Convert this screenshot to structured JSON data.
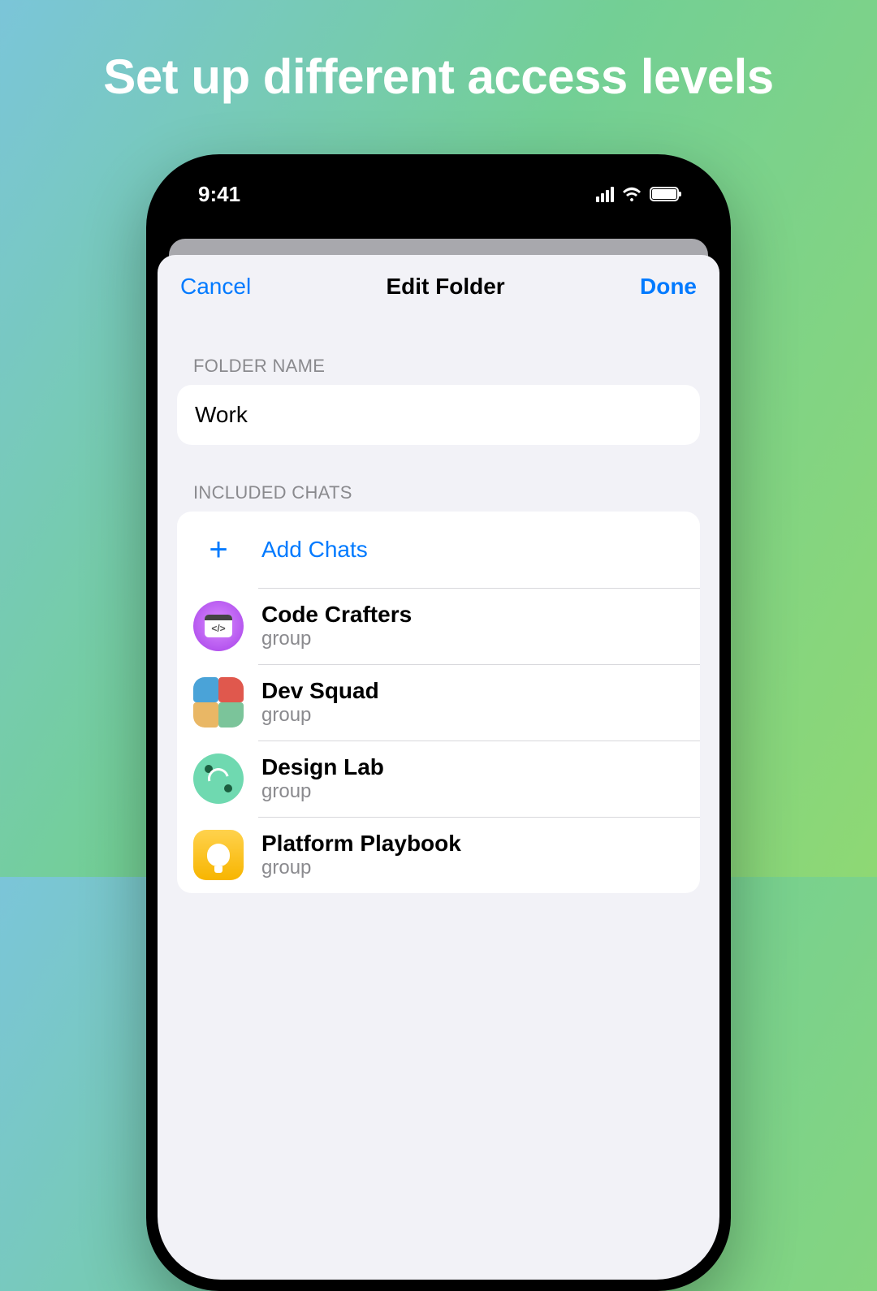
{
  "headline": "Set up different access levels",
  "statusbar": {
    "time": "9:41"
  },
  "navbar": {
    "cancel": "Cancel",
    "title": "Edit Folder",
    "done": "Done"
  },
  "folder_name": {
    "label": "FOLDER NAME",
    "value": "Work"
  },
  "included": {
    "label": "INCLUDED CHATS",
    "add_label": "Add Chats",
    "chats": [
      {
        "title": "Code Crafters",
        "subtitle": "group"
      },
      {
        "title": "Dev Squad",
        "subtitle": "group"
      },
      {
        "title": "Design Lab",
        "subtitle": "group"
      },
      {
        "title": "Platform Playbook",
        "subtitle": "group"
      }
    ]
  }
}
